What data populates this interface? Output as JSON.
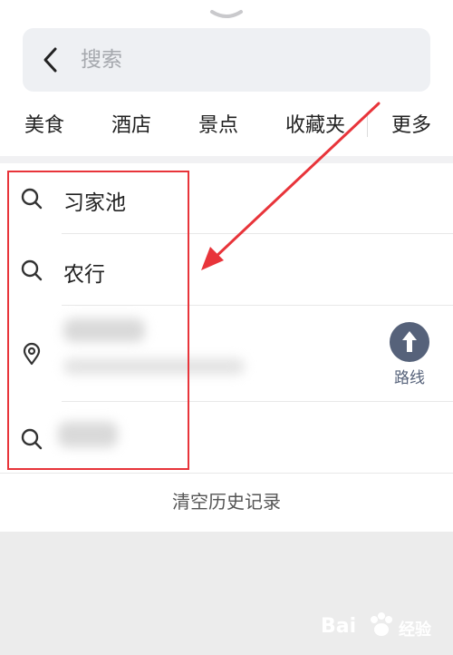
{
  "search": {
    "placeholder": "搜索",
    "value": ""
  },
  "categories": [
    {
      "label": "美食"
    },
    {
      "label": "酒店"
    },
    {
      "label": "景点"
    },
    {
      "label": "收藏夹"
    },
    {
      "label": "更多"
    }
  ],
  "history": [
    {
      "icon": "search-icon",
      "text": "习家池"
    },
    {
      "icon": "search-icon",
      "text": "农行"
    },
    {
      "icon": "location-pin-icon",
      "text": ""
    },
    {
      "icon": "search-icon",
      "text": ""
    }
  ],
  "route": {
    "label": "路线"
  },
  "clear_history": {
    "label": "清空历史记录"
  },
  "colors": {
    "annotation_red": "#e8343a",
    "route_icon": "#56627a",
    "search_bg": "#eef0f3"
  },
  "watermark": {
    "text_left": "Bai",
    "text_right": "经验"
  }
}
